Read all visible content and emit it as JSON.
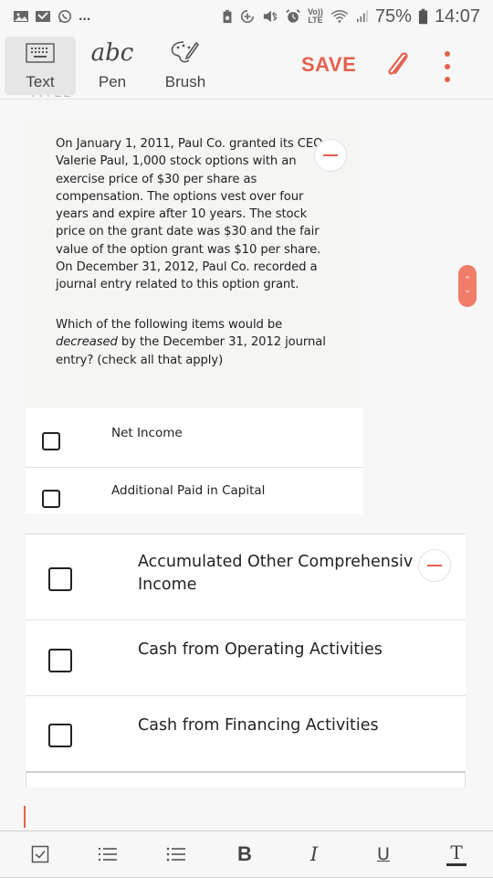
{
  "status_bar": {
    "left_icons": [
      "gallery-icon",
      "email-icon",
      "whatsapp-icon"
    ],
    "overflow": "...",
    "right_icons": [
      "battery-saver-icon",
      "data-saver-icon",
      "mute-icon",
      "alarm-icon",
      "volte-icon",
      "wifi-icon",
      "signal-icon"
    ],
    "volte_top": "Vo))",
    "volte_bottom": "LTE",
    "battery_percent": "75%",
    "time": "14:07"
  },
  "toolbar": {
    "tools": [
      {
        "label": "Text",
        "icon": "keyboard-icon",
        "active": true
      },
      {
        "label": "Pen",
        "icon": "handwriting-icon",
        "active": false
      },
      {
        "label": "Brush",
        "icon": "palette-brush-icon",
        "active": false
      }
    ],
    "save_label": "SAVE",
    "accent_color": "#e2614f"
  },
  "question": {
    "paragraph": "On January 1, 2011, Paul Co. granted its CEO, Valerie Paul, 1,000 stock options with an exercise price of $30 per share as compensation.  The options vest over four years and expire after 10 years.  The stock price on the grant date was $30 and the fair value of the option grant was $10 per share. On December 31, 2012, Paul Co. recorded a journal entry related to this option grant.",
    "prompt_pre": "Which of the following items would be",
    "prompt_emph": "decreased",
    "prompt_post": " by the December 31, 2012 journal entry? (check all that apply)"
  },
  "options": [
    {
      "label": "Net Income",
      "checked": false
    },
    {
      "label": "Additional Paid in Capital",
      "checked": false
    },
    {
      "label": "Accumulated Other Comprehensive Income",
      "label_line1": "Accumulated Other Comprehensiv",
      "label_line2": "Income",
      "checked": false
    },
    {
      "label": "Cash from Operating Activities",
      "checked": false
    },
    {
      "label": "Cash from Financing Activities",
      "checked": false
    }
  ],
  "format_bar": {
    "buttons": [
      {
        "name": "checkbox-format",
        "glyph": "☑"
      },
      {
        "name": "numbered-list",
        "glyph": ""
      },
      {
        "name": "bullet-list",
        "glyph": ""
      },
      {
        "name": "bold",
        "glyph": "B"
      },
      {
        "name": "italic",
        "glyph": "I"
      },
      {
        "name": "underline",
        "glyph": "U"
      },
      {
        "name": "text-color",
        "glyph": "T"
      }
    ]
  }
}
